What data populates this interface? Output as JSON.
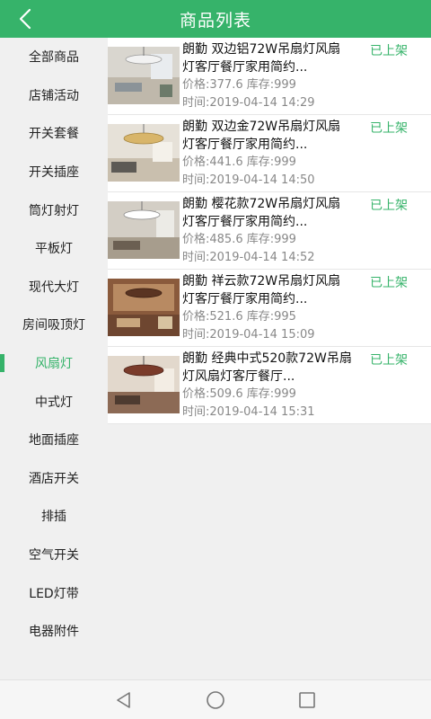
{
  "header": {
    "title": "商品列表"
  },
  "sidebar": {
    "items": [
      {
        "label": "全部商品"
      },
      {
        "label": "店铺活动"
      },
      {
        "label": "开关套餐"
      },
      {
        "label": "开关插座"
      },
      {
        "label": "筒灯射灯"
      },
      {
        "label": "平板灯"
      },
      {
        "label": "现代大灯"
      },
      {
        "label": "房间吸顶灯"
      },
      {
        "label": "风扇灯"
      },
      {
        "label": "中式灯"
      },
      {
        "label": "地面插座"
      },
      {
        "label": "酒店开关"
      },
      {
        "label": "排插"
      },
      {
        "label": "空气开关"
      },
      {
        "label": "LED灯带"
      },
      {
        "label": "电器附件"
      }
    ],
    "active": "风扇灯"
  },
  "products": [
    {
      "title": "朗勤 双边铝72W吊扇灯风扇灯客厅餐厅家用简约...",
      "status": "已上架",
      "price": "价格:377.6",
      "stock": "库存:999",
      "time": "时间:2019-04-14 14:29"
    },
    {
      "title": "朗勤 双边金72W吊扇灯风扇灯客厅餐厅家用简约...",
      "status": "已上架",
      "price": "价格:441.6",
      "stock": "库存:999",
      "time": "时间:2019-04-14 14:50"
    },
    {
      "title": "朗勤 樱花款72W吊扇灯风扇灯客厅餐厅家用简约...",
      "status": "已上架",
      "price": "价格:485.6",
      "stock": "库存:999",
      "time": "时间:2019-04-14 14:52"
    },
    {
      "title": "朗勤 祥云款72W吊扇灯风扇灯客厅餐厅家用简约...",
      "status": "已上架",
      "price": "价格:521.6",
      "stock": "库存:995",
      "time": "时间:2019-04-14 15:09"
    },
    {
      "title": "朗勤 经典中式520款72W吊扇灯风扇灯客厅餐厅...",
      "status": "已上架",
      "price": "价格:509.6",
      "stock": "库存:999",
      "time": "时间:2019-04-14 15:31"
    }
  ],
  "colors": {
    "accent": "#36b36a",
    "background": "#f0f0f0"
  },
  "icons": {
    "back": "chevron-left-icon",
    "nav_back": "triangle-back-icon",
    "nav_home": "circle-home-icon",
    "nav_recent": "square-recent-icon"
  }
}
